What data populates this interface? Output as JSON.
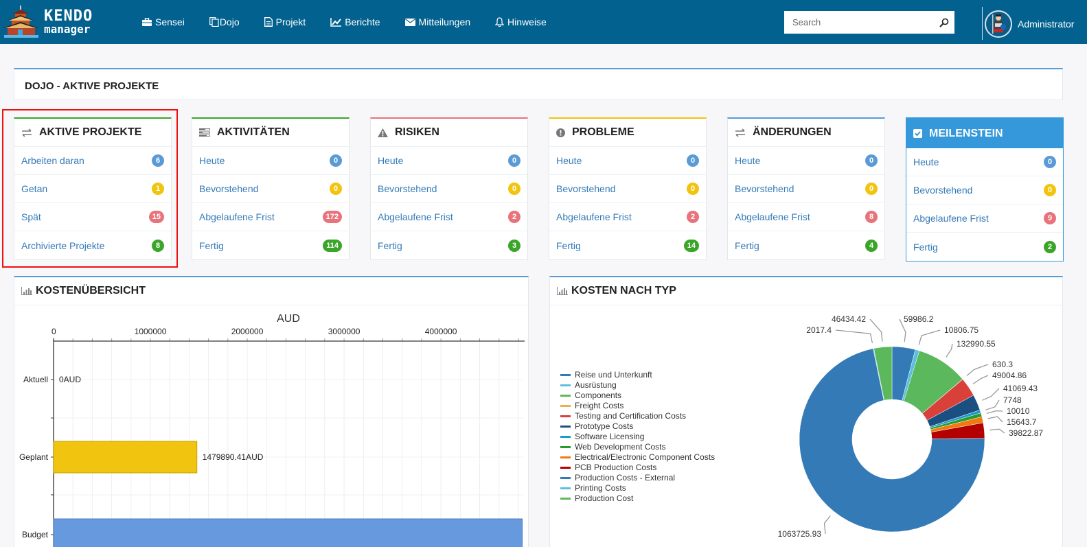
{
  "navbar": {
    "logo": {
      "line1": "KENDO",
      "line2": "manager"
    },
    "items": [
      {
        "label": "Sensei",
        "icon": "briefcase-icon"
      },
      {
        "label": "Dojo",
        "icon": "copy-icon"
      },
      {
        "label": "Projekt",
        "icon": "file-icon"
      },
      {
        "label": "Berichte",
        "icon": "line-chart-icon"
      },
      {
        "label": "Mitteilungen",
        "icon": "envelope-icon"
      },
      {
        "label": "Hinweise",
        "icon": "bell-icon"
      }
    ],
    "search": {
      "placeholder": "Search",
      "value": ""
    },
    "user": {
      "name": "Administrator"
    }
  },
  "page": {
    "title": "DOJO - AKTIVE PROJEKTE"
  },
  "cards": [
    {
      "title": "AKTIVE PROJEKTE",
      "icon": "exchange-icon",
      "accent": "#3ba529",
      "rows": [
        {
          "label": "Arbeiten daran",
          "count": "6",
          "color": "blue"
        },
        {
          "label": "Getan",
          "count": "1",
          "color": "yellow"
        },
        {
          "label": "Spät",
          "count": "15",
          "color": "red"
        },
        {
          "label": "Archivierte Projekte",
          "count": "8",
          "color": "green"
        }
      ]
    },
    {
      "title": "AKTIVITÄTEN",
      "icon": "tasks-icon",
      "accent": "#3ba529",
      "rows": [
        {
          "label": "Heute",
          "count": "0",
          "color": "blue"
        },
        {
          "label": "Bevorstehend",
          "count": "0",
          "color": "yellow"
        },
        {
          "label": "Abgelaufene Frist",
          "count": "172",
          "color": "red"
        },
        {
          "label": "Fertig",
          "count": "114",
          "color": "green"
        }
      ]
    },
    {
      "title": "RISIKEN",
      "icon": "warning-icon",
      "accent": "#e8737b",
      "rows": [
        {
          "label": "Heute",
          "count": "0",
          "color": "blue"
        },
        {
          "label": "Bevorstehend",
          "count": "0",
          "color": "yellow"
        },
        {
          "label": "Abgelaufene Frist",
          "count": "2",
          "color": "red"
        },
        {
          "label": "Fertig",
          "count": "3",
          "color": "green"
        }
      ]
    },
    {
      "title": "PROBLEME",
      "icon": "exclamation-circle-icon",
      "accent": "#f1c40f",
      "rows": [
        {
          "label": "Heute",
          "count": "0",
          "color": "blue"
        },
        {
          "label": "Bevorstehend",
          "count": "0",
          "color": "yellow"
        },
        {
          "label": "Abgelaufene Frist",
          "count": "2",
          "color": "red"
        },
        {
          "label": "Fertig",
          "count": "14",
          "color": "green"
        }
      ]
    },
    {
      "title": "ÄNDERUNGEN",
      "icon": "exchange-icon",
      "accent": "#5b9bd5",
      "rows": [
        {
          "label": "Heute",
          "count": "0",
          "color": "blue"
        },
        {
          "label": "Bevorstehend",
          "count": "0",
          "color": "yellow"
        },
        {
          "label": "Abgelaufene Frist",
          "count": "8",
          "color": "red"
        },
        {
          "label": "Fertig",
          "count": "4",
          "color": "green"
        }
      ]
    },
    {
      "title": "MEILENSTEIN",
      "icon": "check-square-icon",
      "accent": "#3498db",
      "rows": [
        {
          "label": "Heute",
          "count": "0",
          "color": "blue"
        },
        {
          "label": "Bevorstehend",
          "count": "0",
          "color": "yellow"
        },
        {
          "label": "Abgelaufene Frist",
          "count": "9",
          "color": "red"
        },
        {
          "label": "Fertig",
          "count": "2",
          "color": "green"
        }
      ]
    }
  ],
  "panels": {
    "cost_overview": {
      "title": "KOSTENÜBERSICHT",
      "icon": "bar-chart-icon"
    },
    "cost_by_type": {
      "title": "KOSTEN NACH TYP",
      "icon": "bar-chart-icon"
    }
  },
  "colors": {
    "blue": "#5b9bd5",
    "yellow": "#f1c40f",
    "red": "#e8737b",
    "green": "#3ba529",
    "navbar": "#02618e"
  },
  "chart_data": [
    {
      "type": "bar",
      "orientation": "horizontal",
      "title": "AUD",
      "xlabel": "",
      "ylabel": "",
      "categories": [
        "Aktuell",
        "Geplant",
        "Budget"
      ],
      "values": [
        0,
        1479890.41,
        4840000
      ],
      "value_labels": [
        "0AUD",
        "1479890.41AUD",
        ""
      ],
      "colors": [
        "#5b9bd5",
        "#f1c40f",
        "#6699dd"
      ],
      "xlim": [
        0,
        4850000
      ],
      "xticks": [
        0,
        1000000,
        2000000,
        3000000,
        4000000
      ],
      "xtick_labels": [
        "0",
        "1000000",
        "2000000",
        "3000000",
        "4000000"
      ],
      "axis_position": "top",
      "grid": true
    },
    {
      "type": "pie",
      "donut": true,
      "title": "",
      "legend_position": "left",
      "labels": [
        "Reise und Unterkunft",
        "Ausrüstung",
        "Components",
        "Freight Costs",
        "Testing and Certification Costs",
        "Prototype Costs",
        "Software Licensing",
        "Web Development Costs",
        "Electrical/Electronic Component Costs",
        "PCB Production Costs",
        "Production Costs - External",
        "Printing Costs",
        "Production Cost"
      ],
      "values": [
        59986.2,
        10806.75,
        132990.55,
        630.3,
        49004.86,
        41069.43,
        7748,
        10010,
        15643.7,
        39822.87,
        1063725.93,
        2017.4,
        46434.42
      ],
      "value_labels": [
        "59986.2",
        "10806.75",
        "132990.55",
        "630.3",
        "49004.86",
        "41069.43",
        "7748",
        "10010",
        "15643.7",
        "39822.87",
        "1063725.93",
        "2017.4",
        "46434.42"
      ],
      "colors": [
        "#337ab7",
        "#5bc0de",
        "#5cb85c",
        "#f0ad4e",
        "#d9403a",
        "#1b4f82",
        "#1a9bcf",
        "#2a9a2a",
        "#f07a10",
        "#b30000",
        "#337ab7",
        "#5bc0de",
        "#5cb85c"
      ]
    }
  ]
}
